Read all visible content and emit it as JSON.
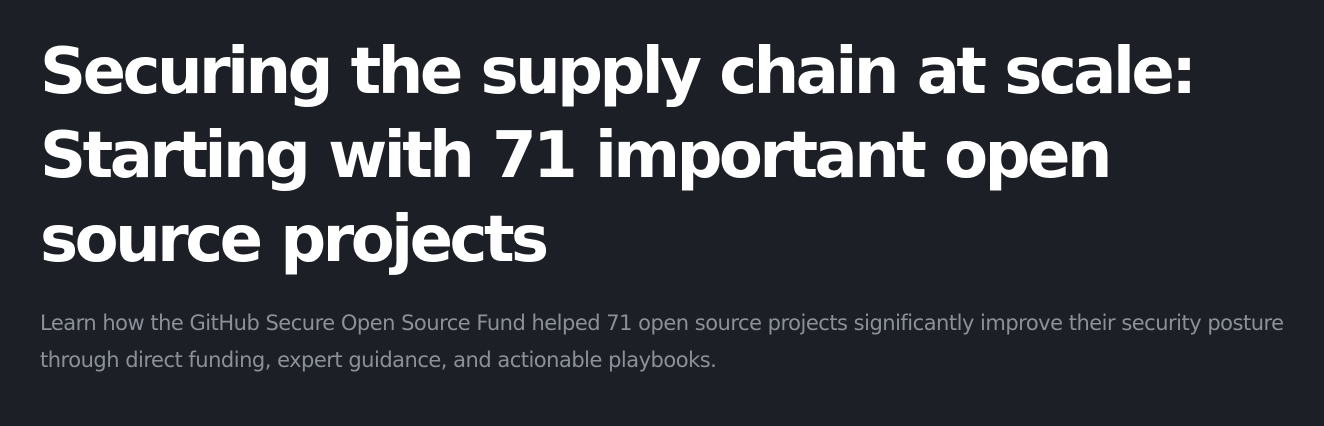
{
  "article": {
    "title_line_1": "Securing the supply chain at scale:",
    "title_line_2": "Starting with 71 important open",
    "title_line_3": "source projects",
    "summary": "Learn how the GitHub Secure Open Source Fund helped 71 open source projects significantly improve their security posture through direct funding, expert guidance, and actionable playbooks."
  },
  "colors": {
    "background": "#1c1f25",
    "title": "#ffffff",
    "summary": "#8b9099"
  }
}
